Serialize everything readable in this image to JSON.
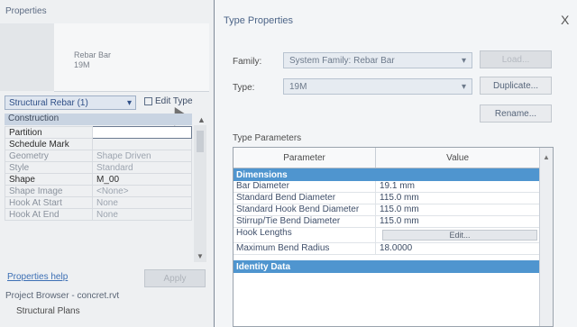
{
  "properties": {
    "title": "Properties",
    "family_line1": "Rebar Bar",
    "family_line2": "19M",
    "type_selector": "Structural Rebar (1)",
    "edit_type": "Edit Type",
    "group": "Construction",
    "rows": [
      {
        "label": "Partition",
        "value": ""
      },
      {
        "label": "Schedule Mark",
        "value": ""
      },
      {
        "label": "Geometry",
        "value": "Shape Driven"
      },
      {
        "label": "Style",
        "value": "Standard"
      },
      {
        "label": "Shape",
        "value": "M_00"
      },
      {
        "label": "Shape Image",
        "value": "<None>"
      },
      {
        "label": "Hook At Start",
        "value": "None"
      },
      {
        "label": "Hook At End",
        "value": "None"
      }
    ],
    "help_link": "Properties help",
    "apply": "Apply"
  },
  "project_browser": {
    "title": "Project Browser - concret.rvt",
    "item": "Structural Plans"
  },
  "type_properties": {
    "title": "Type Properties",
    "close": "X",
    "family_label": "Family:",
    "family_value": "System Family: Rebar Bar",
    "type_label": "Type:",
    "type_value": "19M",
    "load_button": "Load...",
    "duplicate_button": "Duplicate...",
    "rename_button": "Rename...",
    "type_parameters_label": "Type Parameters",
    "col_parameter": "Parameter",
    "col_value": "Value",
    "groups": [
      {
        "name": "Dimensions",
        "rows": [
          {
            "k": "Bar Diameter",
            "v": "19.1 mm"
          },
          {
            "k": "Standard Bend Diameter",
            "v": "115.0 mm"
          },
          {
            "k": "Standard Hook Bend Diameter",
            "v": "115.0 mm"
          },
          {
            "k": "Stirrup/Tie Bend Diameter",
            "v": "115.0 mm"
          },
          {
            "k": "Hook Lengths",
            "v": "Edit..."
          },
          {
            "k": "Maximum Bend Radius",
            "v": "18.0000"
          }
        ]
      },
      {
        "name": "Identity Data",
        "rows": []
      }
    ]
  },
  "colors": {
    "accent": "#4f95cf",
    "link": "#3c6fb4"
  }
}
